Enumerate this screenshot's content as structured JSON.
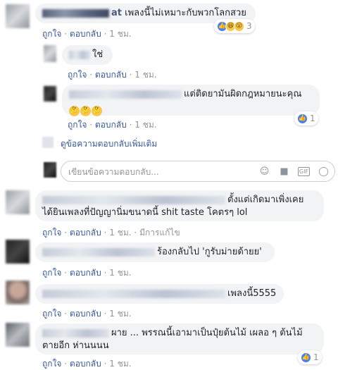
{
  "actions": {
    "like": "ถูกใจ",
    "reply": "ตอบกลับ",
    "sep": "·",
    "time": "1 ชม.",
    "edited": "มีการแก้ไข"
  },
  "comments": [
    {
      "text": "เพลงนี้ไม่เหมาะกับพวกโลกสวย",
      "name_tail": "at",
      "reaction_count": "3"
    },
    {
      "text": "ใช่"
    },
    {
      "text": "แต่ติดยามันผิดกฎหมายนะคุณ",
      "reaction_count": "1"
    },
    {
      "text": "ตั้งแต่เกิดมาเพิ่งเคยได้ยินเพลงที่ปัญญานิ่มขนาดนี้ shit taste โคตรๆ lol"
    },
    {
      "text": "ร้องกลับไป 'กูรับม่ายด้ายย'"
    },
    {
      "text": "เพลงนี้5555"
    },
    {
      "text": "ผาย ... พรรณนี้เอามาเป็นปุ๋ยต้นไม้ เผลอ ๆ ต้นไม้ตายอีก ห่านนนน",
      "reaction_count": "1"
    }
  ],
  "more_replies": "ดูข้อความตอบกลับเพิ่มเติม",
  "reply_placeholder": "เขียนข้อความตอบกลับ...",
  "icons": [
    "like-icon",
    "haha-icon",
    "wow-icon",
    "emoji-icon",
    "camera-icon",
    "gif-icon",
    "sticker-icon"
  ]
}
